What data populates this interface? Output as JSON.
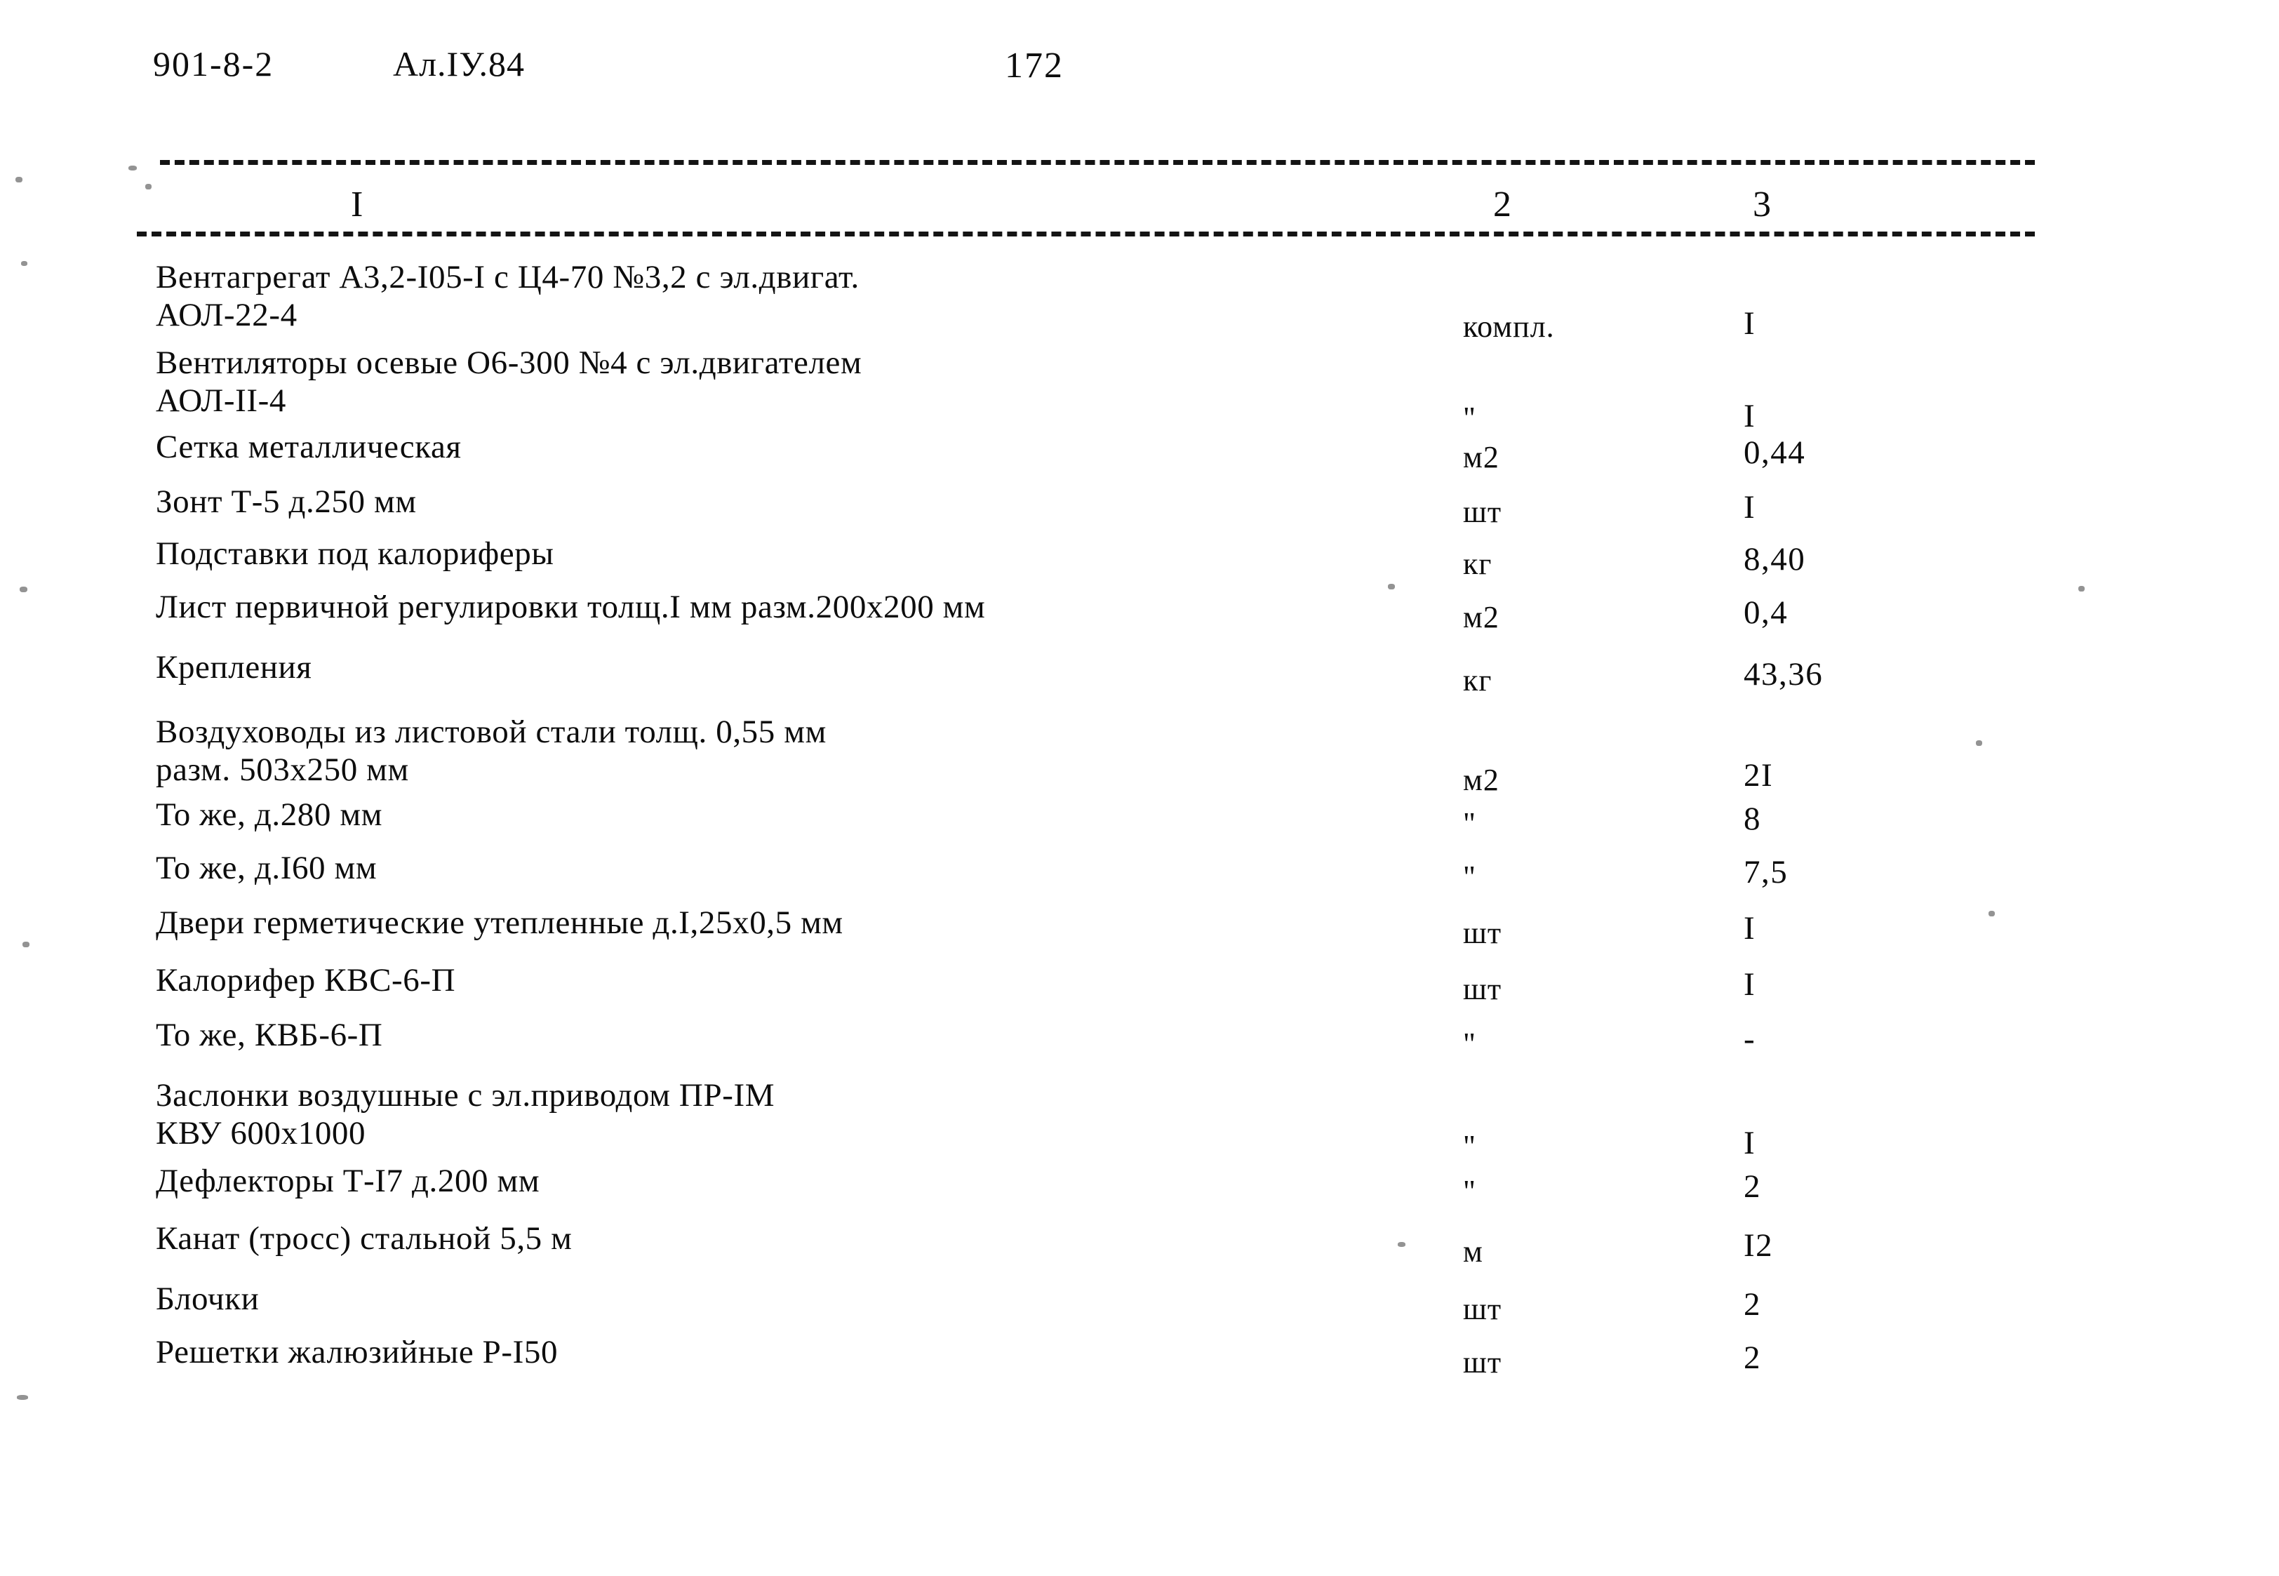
{
  "header": {
    "doc_code": "901-8-2",
    "album": "Ал.IУ.84",
    "page_number": "172"
  },
  "table": {
    "column_headers": {
      "col1": "I",
      "col2": "2",
      "col3": "3"
    },
    "rows": [
      {
        "name_line1": "Вентагрегат А3,2-I05-I с Ц4-70 №3,2 с эл.двигат.",
        "name_line2": "АОЛ-22-4",
        "unit": "компл.",
        "qty": "I"
      },
      {
        "name_line1": "Вентиляторы осевые О6-300 №4 с эл.двигателем",
        "name_line2": "АОЛ-II-4",
        "unit": "\"",
        "qty": "I"
      },
      {
        "name_line1": "Сетка металлическая",
        "name_line2": "",
        "unit": "м2",
        "qty": "0,44"
      },
      {
        "name_line1": "Зонт Т-5 д.250 мм",
        "name_line2": "",
        "unit": "шт",
        "qty": "I"
      },
      {
        "name_line1": "Подставки под калориферы",
        "name_line2": "",
        "unit": "кг",
        "qty": "8,40"
      },
      {
        "name_line1": "Лист первичной регулировки толщ.I мм разм.200х200 мм",
        "name_line2": "",
        "unit": "м2",
        "qty": "0,4"
      },
      {
        "name_line1": "Крепления",
        "name_line2": "",
        "unit": "кг",
        "qty": "43,36"
      },
      {
        "name_line1": "Воздуховоды из листовой стали толщ. 0,55 мм",
        "name_line2": "разм. 503х250 мм",
        "unit": "м2",
        "qty": "2I"
      },
      {
        "name_line1": "То же, д.280 мм",
        "name_line2": "",
        "unit": "\"",
        "qty": "8"
      },
      {
        "name_line1": "То же, д.I60 мм",
        "name_line2": "",
        "unit": "\"",
        "qty": "7,5"
      },
      {
        "name_line1": "Двери герметические утепленные д.I,25х0,5 мм",
        "name_line2": "",
        "unit": "шт",
        "qty": "I"
      },
      {
        "name_line1": "Калорифер КВС-6-П",
        "name_line2": "",
        "unit": "шт",
        "qty": "I"
      },
      {
        "name_line1": "То же, КВБ-6-П",
        "name_line2": "",
        "unit": "\"",
        "qty": "-"
      },
      {
        "name_line1": "Заслонки воздушные с эл.приводом ПР-IМ",
        "name_line2": "КВУ 600х1000",
        "unit": "\"",
        "qty": "I"
      },
      {
        "name_line1": "Дефлекторы Т-I7 д.200 мм",
        "name_line2": "",
        "unit": "\"",
        "qty": "2"
      },
      {
        "name_line1": "Канат (тросс) стальной 5,5 м",
        "name_line2": "",
        "unit": "м",
        "qty": "I2"
      },
      {
        "name_line1": "Блочки",
        "name_line2": "",
        "unit": "шт",
        "qty": "2"
      },
      {
        "name_line1": "Решетки жалюзийные Р-I50",
        "name_line2": "",
        "unit": "шт",
        "qty": "2"
      }
    ]
  }
}
